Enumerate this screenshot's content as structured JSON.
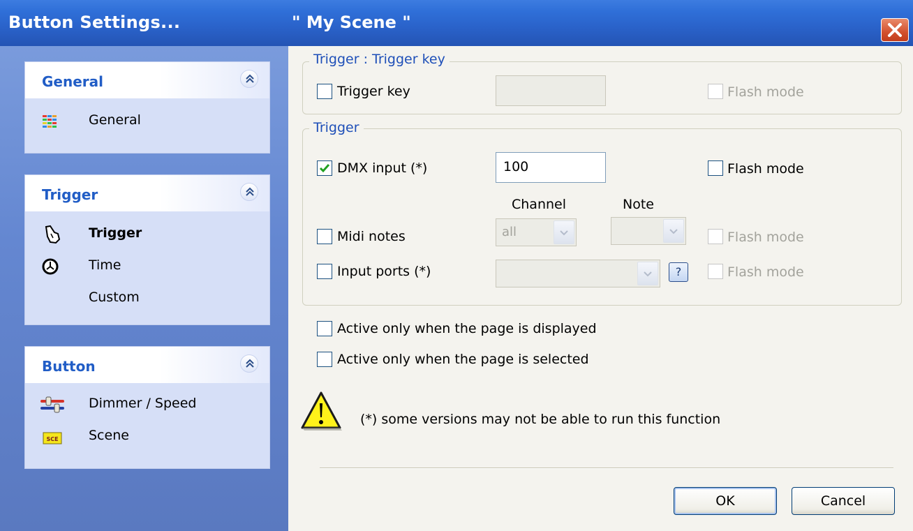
{
  "window": {
    "title": "Button Settings...",
    "scene_title": "\" My Scene \"",
    "accent": "#2a62c9",
    "close_color": "#d2512e"
  },
  "sidebar": {
    "groups": [
      {
        "title": "General",
        "items": [
          {
            "label": "General",
            "icon": "grid-colors-icon",
            "selected": false
          }
        ]
      },
      {
        "title": "Trigger",
        "items": [
          {
            "label": "Trigger",
            "icon": "hand-pointer-icon",
            "selected": true
          },
          {
            "label": "Time",
            "icon": "clock-icon",
            "selected": false
          },
          {
            "label": "Custom",
            "icon": "",
            "selected": false
          }
        ]
      },
      {
        "title": "Button",
        "items": [
          {
            "label": "Dimmer / Speed",
            "icon": "sliders-icon",
            "selected": false
          },
          {
            "label": "Scene",
            "icon": "scene-icon",
            "selected": false
          }
        ]
      }
    ]
  },
  "trigger_key": {
    "legend": "Trigger : Trigger key",
    "checkbox_label": "Trigger key",
    "checked": false,
    "value": "",
    "flash_label": "Flash mode",
    "flash_enabled": false
  },
  "trigger": {
    "legend": "Trigger",
    "dmx": {
      "label": "DMX input (*)",
      "checked": true,
      "value": "100",
      "flash_label": "Flash mode",
      "flash_checked": false
    },
    "col_channel": "Channel",
    "col_note": "Note",
    "midi": {
      "label": "Midi notes",
      "checked": false,
      "channel_value": "all",
      "note_value": "",
      "flash_label": "Flash mode"
    },
    "ports": {
      "label": "Input ports (*)",
      "checked": false,
      "value": "",
      "help_label": "?",
      "flash_label": "Flash mode"
    }
  },
  "options": {
    "active_displayed": "Active only when the page is displayed",
    "active_selected": "Active only when the page is selected"
  },
  "warning_text": "(*) some versions may not be able to run this function",
  "buttons": {
    "ok": "OK",
    "cancel": "Cancel"
  }
}
